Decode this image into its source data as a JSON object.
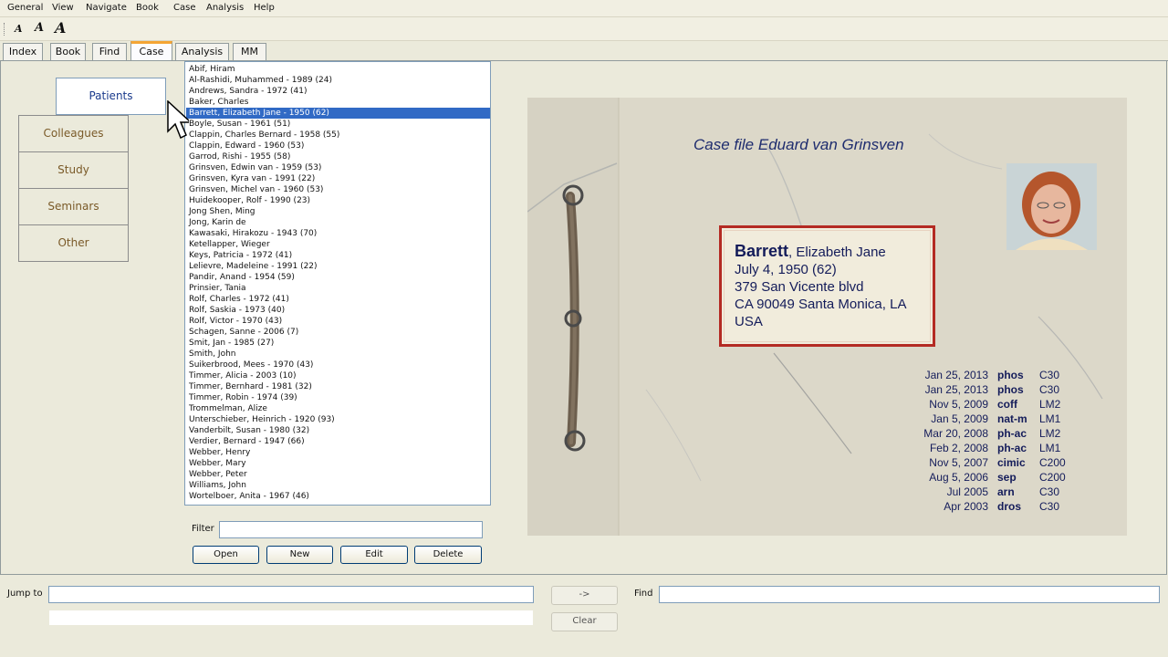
{
  "menu": [
    "General",
    "View",
    "Navigate",
    "Book",
    "Case",
    "Analysis",
    "Help"
  ],
  "toolbar": {
    "font_small": "A",
    "font_medium": "A",
    "font_large": "A"
  },
  "tabs": [
    "Index",
    "Book",
    "Find",
    "Case",
    "Analysis",
    "MM"
  ],
  "active_tab": "Case",
  "categories": [
    "Patients",
    "Colleagues",
    "Study",
    "Seminars",
    "Other"
  ],
  "patients": [
    "Abif, Hiram",
    "Al-Rashidi, Muhammed - 1989 (24)",
    "Andrews, Sandra - 1972 (41)",
    "Baker, Charles",
    "Barrett, Elizabeth Jane - 1950 (62)",
    "Boyle, Susan - 1961 (51)",
    "Clappin, Charles Bernard - 1958 (55)",
    "Clappin, Edward - 1960 (53)",
    "Garrod, Rishi - 1955 (58)",
    "Grinsven, Edwin van - 1959 (53)",
    "Grinsven, Kyra van - 1991 (22)",
    "Grinsven, Michel van - 1960 (53)",
    "Huidekooper, Rolf - 1990 (23)",
    "Jong Shen, Ming",
    "Jong, Karin de",
    "Kawasaki, Hirakozu - 1943 (70)",
    "Ketellapper, Wieger",
    "Keys, Patricia - 1972 (41)",
    "Lelievre, Madeleine - 1991 (22)",
    "Pandir, Anand - 1954 (59)",
    "Prinsier, Tania",
    "Rolf, Charles - 1972 (41)",
    "Rolf, Saskia - 1973 (40)",
    "Rolf, Victor - 1970 (43)",
    "Schagen, Sanne - 2006 (7)",
    "Smit, Jan - 1985 (27)",
    "Smith, John",
    "Suikerbrood, Mees - 1970 (43)",
    "Timmer, Alicia - 2003 (10)",
    "Timmer, Bernhard - 1981 (32)",
    "Timmer, Robin - 1974 (39)",
    "Trommelman, Alize",
    "Unterschieber, Heinrich - 1920 (93)",
    "Vanderbilt, Susan - 1980 (32)",
    "Verdier, Bernard - 1947 (66)",
    "Webber, Henry",
    "Webber, Mary",
    "Webber, Peter",
    "Williams, John",
    "Wortelboer, Anita - 1967 (46)"
  ],
  "selected_patient": "Barrett, Elizabeth Jane - 1950 (62)",
  "filter": {
    "label": "Filter",
    "value": ""
  },
  "buttons": {
    "open": "Open",
    "new": "New",
    "edit": "Edit",
    "delete": "Delete"
  },
  "casefile": {
    "title": "Case file Eduard van Grinsven",
    "surname": "Barrett",
    "given_names": ", Elizabeth Jane",
    "birth": "July 4, 1950 (62)",
    "address1": "379 San Vicente blvd",
    "address2": "CA 90049  Santa Monica, LA",
    "country": "USA"
  },
  "prescriptions": [
    {
      "date": "Jan 25, 2013",
      "remedy": "phos",
      "potency": "C30"
    },
    {
      "date": "Jan 25, 2013",
      "remedy": "phos",
      "potency": "C30"
    },
    {
      "date": "Nov 5, 2009",
      "remedy": "coff",
      "potency": "LM2"
    },
    {
      "date": "Jan 5, 2009",
      "remedy": "nat-m",
      "potency": "LM1"
    },
    {
      "date": "Mar 20, 2008",
      "remedy": "ph-ac",
      "potency": "LM2"
    },
    {
      "date": "Feb 2, 2008",
      "remedy": "ph-ac",
      "potency": "LM1"
    },
    {
      "date": "Nov 5, 2007",
      "remedy": "cimic",
      "potency": "C200"
    },
    {
      "date": "Aug 5, 2006",
      "remedy": "sep",
      "potency": "C200"
    },
    {
      "date": "Jul 2005",
      "remedy": "arn",
      "potency": "C30"
    },
    {
      "date": "Apr 2003",
      "remedy": "dros",
      "potency": "C30"
    }
  ],
  "bottom": {
    "jump_label": "Jump to",
    "jump_value": "",
    "arrow_button": "->",
    "clear_button": "Clear",
    "find_label": "Find",
    "find_value": ""
  },
  "colors": {
    "selection": "#316ac5",
    "tab_highlight": "#f4a534",
    "card_border": "#b42a23",
    "case_text": "#141c5a"
  }
}
